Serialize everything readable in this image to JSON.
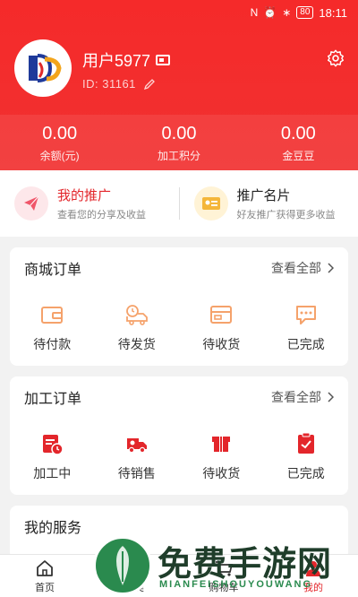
{
  "status_bar": {
    "time": "18:11",
    "battery": "80"
  },
  "profile": {
    "username": "用户5977",
    "id_label": "ID:  31161"
  },
  "stats": [
    {
      "value": "0.00",
      "label": "余额(元)"
    },
    {
      "value": "0.00",
      "label": "加工积分"
    },
    {
      "value": "0.00",
      "label": "金豆豆"
    }
  ],
  "promo": [
    {
      "title": "我的推广",
      "subtitle": "查看您的分享及收益"
    },
    {
      "title": "推广名片",
      "subtitle": "好友推广获得更多收益"
    }
  ],
  "mall_orders": {
    "title": "商城订单",
    "more": "查看全部",
    "items": [
      {
        "label": "待付款",
        "icon": "wallet-icon"
      },
      {
        "label": "待发货",
        "icon": "delivery-truck-icon"
      },
      {
        "label": "待收货",
        "icon": "package-card-icon"
      },
      {
        "label": "已完成",
        "icon": "chat-bubble-icon"
      }
    ]
  },
  "processing_orders": {
    "title": "加工订单",
    "more": "查看全部",
    "items": [
      {
        "label": "加工中",
        "icon": "process-clock-icon"
      },
      {
        "label": "待销售",
        "icon": "truck-icon"
      },
      {
        "label": "待收货",
        "icon": "box-icon"
      },
      {
        "label": "已完成",
        "icon": "checklist-icon"
      }
    ]
  },
  "services": {
    "title": "我的服务"
  },
  "tabbar": [
    {
      "label": "首页"
    },
    {
      "label": "分类"
    },
    {
      "label": "购物车"
    },
    {
      "label": "我的"
    }
  ],
  "watermark": {
    "text": "免费手游网",
    "sub": "MIANFEISHOUYOUWANG"
  },
  "colors": {
    "brand_red": "#f52a2a",
    "accent_orange": "#f5a26b",
    "accent_red": "#e3262b"
  }
}
